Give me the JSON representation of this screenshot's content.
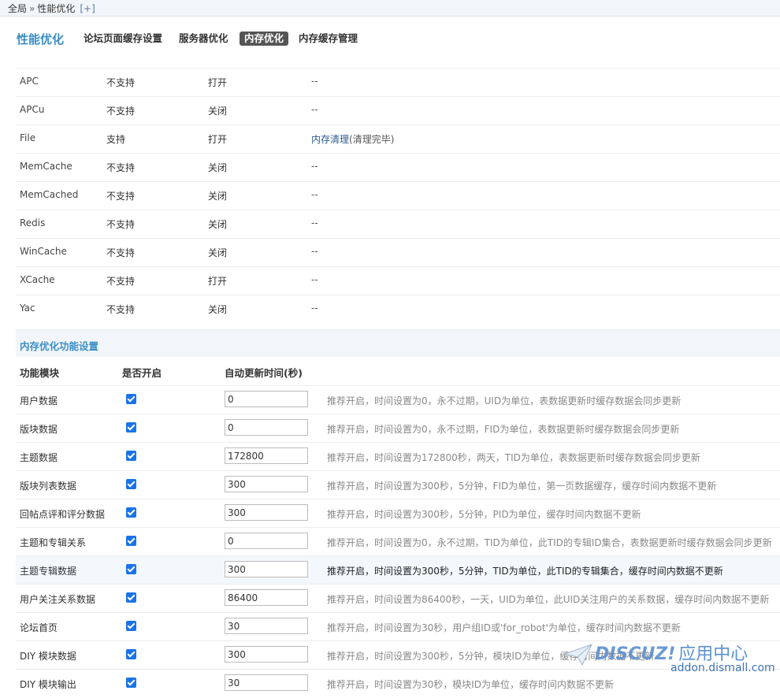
{
  "breadcrumb": {
    "root": "全局",
    "sep": "»",
    "current": "性能优化",
    "add": "[+]"
  },
  "nav": {
    "title": "性能优化",
    "tabs": [
      {
        "label": "论坛页面缓存设置",
        "active": false
      },
      {
        "label": "服务器优化",
        "active": false
      },
      {
        "label": "内存优化",
        "active": true
      },
      {
        "label": "内存缓存管理",
        "active": false
      }
    ]
  },
  "support_table": [
    {
      "name": "APC",
      "support": "不支持",
      "state": "打开",
      "info": "--"
    },
    {
      "name": "APCu",
      "support": "不支持",
      "state": "关闭",
      "info": "--"
    },
    {
      "name": "File",
      "support": "支持",
      "state": "打开",
      "info_link": "内存清理",
      "info_suffix": "(清理完毕)"
    },
    {
      "name": "MemCache",
      "support": "不支持",
      "state": "关闭",
      "info": "--"
    },
    {
      "name": "MemCached",
      "support": "不支持",
      "state": "关闭",
      "info": "--"
    },
    {
      "name": "Redis",
      "support": "不支持",
      "state": "关闭",
      "info": "--"
    },
    {
      "name": "WinCache",
      "support": "不支持",
      "state": "关闭",
      "info": "--"
    },
    {
      "name": "XCache",
      "support": "不支持",
      "state": "打开",
      "info": "--"
    },
    {
      "name": "Yac",
      "support": "不支持",
      "state": "关闭",
      "info": "--"
    }
  ],
  "section": {
    "title": "内存优化功能设置"
  },
  "columns": {
    "module": "功能模块",
    "enabled": "是否开启",
    "ttl": "自动更新时间(秒)"
  },
  "modules": [
    {
      "name": "用户数据",
      "checked": true,
      "ttl": "0",
      "desc": "推荐开启，时间设置为0，永不过期，UID为单位，表数据更新时缓存数据会同步更新"
    },
    {
      "name": "版块数据",
      "checked": true,
      "ttl": "0",
      "desc": "推荐开启，时间设置为0，永不过期，FID为单位，表数据更新时缓存数据会同步更新"
    },
    {
      "name": "主题数据",
      "checked": true,
      "ttl": "172800",
      "desc": "推荐开启，时间设置为172800秒，两天，TID为单位，表数据更新时缓存数据会同步更新"
    },
    {
      "name": "版块列表数据",
      "checked": true,
      "ttl": "300",
      "desc": "推荐开启，时间设置为300秒，5分钟，FID为单位，第一页数据缓存，缓存时间内数据不更新"
    },
    {
      "name": "回帖点评和评分数据",
      "checked": true,
      "ttl": "300",
      "desc": "推荐开启，时间设置为300秒，5分钟，PID为单位，缓存时间内数据不更新"
    },
    {
      "name": "主题和专辑关系",
      "checked": true,
      "ttl": "0",
      "desc": "推荐开启，时间设置为0，永不过期，TID为单位，此TID的专辑ID集合，表数据更新时缓存数据会同步更新"
    },
    {
      "name": "主题专辑数据",
      "checked": true,
      "ttl": "300",
      "desc": "推荐开启，时间设置为300秒，5分钟，TID为单位，此TID的专辑集合，缓存时间内数据不更新",
      "highlight": true
    },
    {
      "name": "用户关注关系数据",
      "checked": true,
      "ttl": "86400",
      "desc": "推荐开启，时间设置为86400秒，一天，UID为单位，此UID关注用户的关系数据，缓存时间内数据不更新"
    },
    {
      "name": "论坛首页",
      "checked": true,
      "ttl": "30",
      "desc": "推荐开启，时间设置为30秒，用户组ID或'for_robot'为单位，缓存时间内数据不更新"
    },
    {
      "name": "DIY 模块数据",
      "checked": true,
      "ttl": "300",
      "desc": "推荐开启，时间设置为300秒，5分钟，模块ID为单位，缓存时间内数据不更新"
    },
    {
      "name": "DIY 模块输出",
      "checked": true,
      "ttl": "30",
      "desc": "推荐开启，时间设置为30秒，模块ID为单位，缓存时间内数据不更新"
    }
  ],
  "watermark": {
    "brand": "DISCUZ!",
    "brand_cn": "应用中心",
    "url": "addon.dismall.com"
  }
}
